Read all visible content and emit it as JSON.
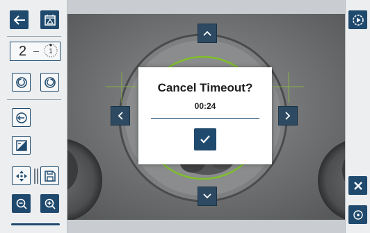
{
  "counter": {
    "value": "2",
    "dial_value": "1"
  },
  "dialog": {
    "title": "Cancel Timeout?",
    "countdown": "00:24"
  },
  "colors": {
    "toolbar_dark": "#1f4a6e",
    "toolbar_bg": "#eceef0",
    "dialog_bg": "#ffffff",
    "ring_green": "#7fbf2a",
    "crosshair": "#8bbd3a"
  },
  "icons": {
    "back": "arrow-left-icon",
    "calendar": "calendar-icon",
    "rotate_ccw": "rotate-ccw-icon",
    "rotate_cw": "rotate-cw-icon",
    "target": "target-back-icon",
    "contrast": "contrast-icon",
    "move": "move-icon",
    "save": "save-icon",
    "zoom_out": "zoom-out-icon",
    "zoom_in": "zoom-in-icon",
    "play": "play-circle-icon",
    "close": "close-icon",
    "record": "record-icon",
    "up": "chevron-up-icon",
    "down": "chevron-down-icon",
    "left": "chevron-left-icon",
    "right": "chevron-right-icon",
    "check": "checkmark-icon"
  }
}
